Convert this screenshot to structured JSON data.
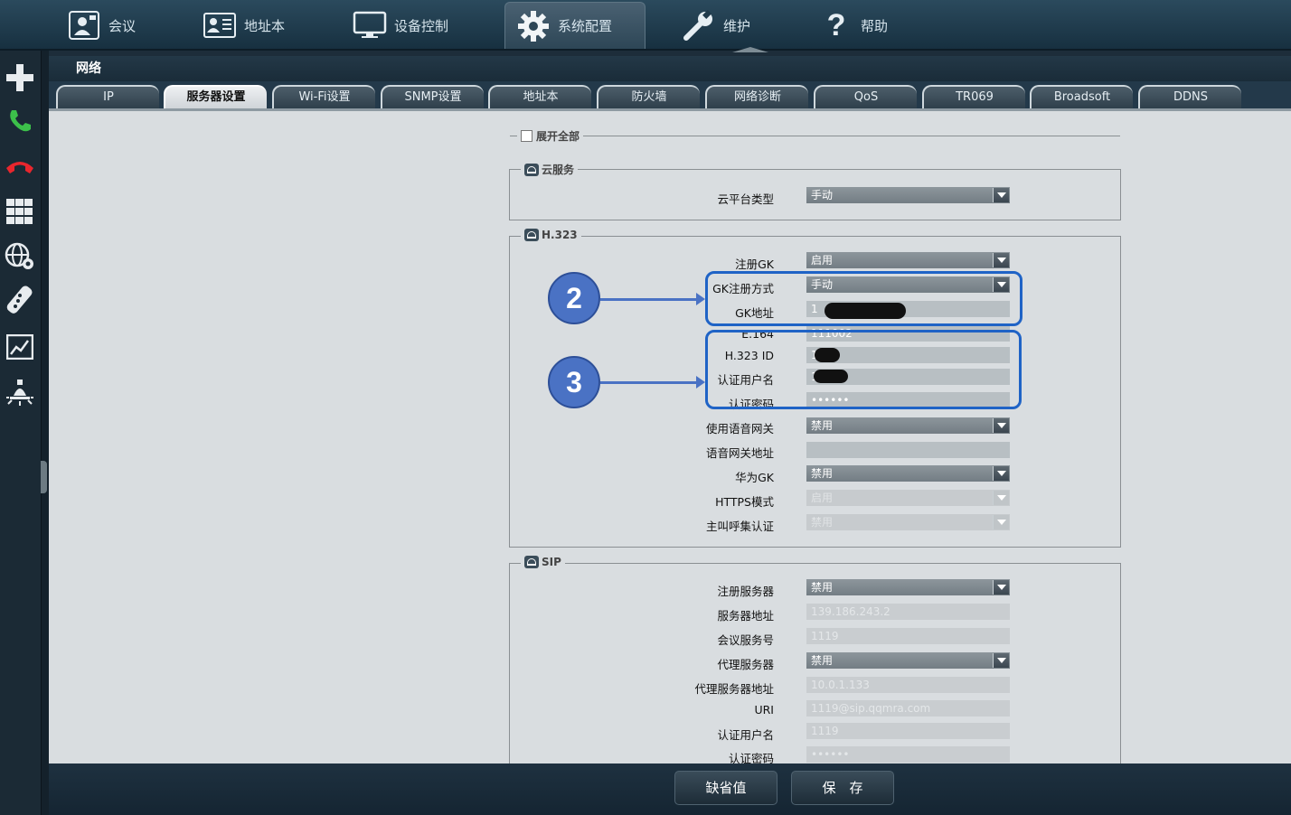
{
  "top_nav": [
    {
      "label": "会议",
      "icon": "conference-icon"
    },
    {
      "label": "地址本",
      "icon": "address-book-icon"
    },
    {
      "label": "设备控制",
      "icon": "monitor-icon"
    },
    {
      "label": "系统配置",
      "icon": "gear-icon",
      "active": true
    },
    {
      "label": "维护",
      "icon": "wrench-icon"
    },
    {
      "label": "帮助",
      "icon": "help-icon"
    }
  ],
  "sidebar": [
    "add-icon",
    "call-icon",
    "hangup-icon",
    "grid-icon",
    "network-settings-icon",
    "remote-control-icon",
    "chart-icon",
    "light-icon"
  ],
  "section_title": "网络",
  "subtabs": [
    "IP",
    "服务器设置",
    "Wi-Fi设置",
    "SNMP设置",
    "地址本",
    "防火墙",
    "网络诊断",
    "QoS",
    "TR069",
    "Broadsoft",
    "DDNS"
  ],
  "active_subtab": "服务器设置",
  "expand_all": "展开全部",
  "cloud": {
    "legend": "云服务",
    "platform_type_label": "云平台类型",
    "platform_type_value": "手动"
  },
  "h323": {
    "legend": "H.323",
    "rows": [
      {
        "label": "注册GK",
        "value": "启用"
      },
      {
        "label": "GK注册方式",
        "value": "手动"
      },
      {
        "label": "GK地址",
        "value": "1"
      },
      {
        "label": "E.164",
        "value": "111002"
      },
      {
        "label": "H.323 ID",
        "value": "1"
      },
      {
        "label": "认证用户名",
        "value": "1"
      },
      {
        "label": "认证密码",
        "value": "••••••"
      },
      {
        "label": "使用语音网关",
        "value": "禁用"
      },
      {
        "label": "语音网关地址",
        "value": ""
      },
      {
        "label": "华为GK",
        "value": "禁用"
      },
      {
        "label": "HTTPS模式",
        "value": "启用"
      },
      {
        "label": "主叫呼集认证",
        "value": "禁用"
      }
    ]
  },
  "sip": {
    "legend": "SIP",
    "rows": [
      {
        "label": "注册服务器",
        "value": "禁用"
      },
      {
        "label": "服务器地址",
        "value": "139.186.243.2"
      },
      {
        "label": "会议服务号",
        "value": "1119"
      },
      {
        "label": "代理服务器",
        "value": "禁用"
      },
      {
        "label": "代理服务器地址",
        "value": "10.0.1.133"
      },
      {
        "label": "URI",
        "value": "1119@sip.qqmra.com"
      },
      {
        "label": "认证用户名",
        "value": "1119"
      },
      {
        "label": "认证密码",
        "value": "••••••"
      }
    ]
  },
  "annotations": [
    "2",
    "3"
  ],
  "buttons": {
    "default": "缺省值",
    "save": "保　存"
  },
  "colors": {
    "annotation": "#1f63c6",
    "active_tab": "#eef0f2",
    "topbar": "#1f3a4b"
  }
}
